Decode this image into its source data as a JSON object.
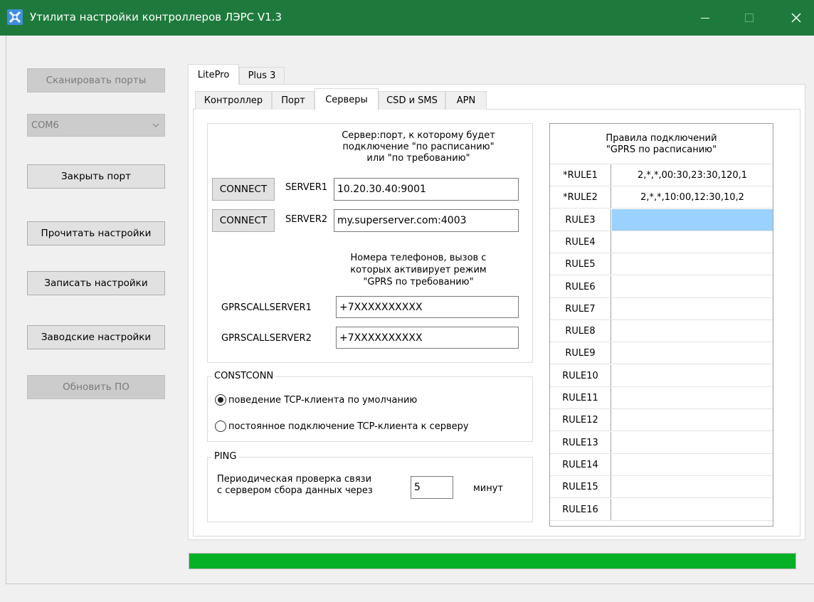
{
  "window": {
    "title": "Утилита настройки контроллеров ЛЭРС V1.3",
    "accent": "#1e7a3c"
  },
  "left_panel": {
    "scan_ports": "Сканировать порты",
    "port_select": "COM6",
    "close_port": "Закрыть порт",
    "read_settings": "Прочитать настройки",
    "write_settings": "Записать настройки",
    "factory_settings": "Заводские настройки",
    "update_firmware": "Обновить ПО"
  },
  "device_tabs": [
    "LitePro",
    "Plus 3"
  ],
  "settings_tabs": [
    "Контроллер",
    "Порт",
    "Серверы",
    "CSD и SMS",
    "APN"
  ],
  "servers": {
    "description_lines": [
      "Сервер:порт, к которому будет",
      "подключение \"по расписанию\"",
      "или \"по требованию\""
    ],
    "connect_label": "CONNECT",
    "server1_label": "SERVER1",
    "server1_value": "10.20.30.40:9001",
    "server2_label": "SERVER2",
    "server2_value": "my.superserver.com:4003"
  },
  "phones": {
    "description_lines": [
      "Номера телефонов, вызов с",
      "которых активирует режим",
      "\"GPRS по требованию\""
    ],
    "call1_label": "GPRSCALLSERVER1",
    "call1_value": "+7XXXXXXXXXX",
    "call2_label": "GPRSCALLSERVER2",
    "call2_value": "+7XXXXXXXXXX"
  },
  "constconn": {
    "title": "CONSTCONN",
    "option_default": "поведение TCP-клиента по умолчанию",
    "option_permanent": "постоянное подключение TCP-клиента к серверу",
    "selected": "default"
  },
  "ping": {
    "title": "PING",
    "text_lines": [
      "Периодическая проверка связи",
      "с сервером сбора данных через"
    ],
    "value": "5",
    "unit": "минут"
  },
  "rules": {
    "title_lines": [
      "Правила подключений",
      "\"GPRS по расписанию\""
    ],
    "items": [
      {
        "name": "*RULE1",
        "value": "2,*,*,00:30,23:30,120,1"
      },
      {
        "name": "*RULE2",
        "value": "2,*,*,10:00,12:30,10,2"
      },
      {
        "name": "RULE3",
        "value": ""
      },
      {
        "name": "RULE4",
        "value": ""
      },
      {
        "name": "RULE5",
        "value": ""
      },
      {
        "name": "RULE6",
        "value": ""
      },
      {
        "name": "RULE7",
        "value": ""
      },
      {
        "name": "RULE8",
        "value": ""
      },
      {
        "name": "RULE9",
        "value": ""
      },
      {
        "name": "RULE10",
        "value": ""
      },
      {
        "name": "RULE11",
        "value": ""
      },
      {
        "name": "RULE12",
        "value": ""
      },
      {
        "name": "RULE13",
        "value": ""
      },
      {
        "name": "RULE14",
        "value": ""
      },
      {
        "name": "RULE15",
        "value": ""
      },
      {
        "name": "RULE16",
        "value": ""
      }
    ],
    "selected_index": 2
  },
  "progress": {
    "fraction": 1.0,
    "color": "#06b025"
  }
}
